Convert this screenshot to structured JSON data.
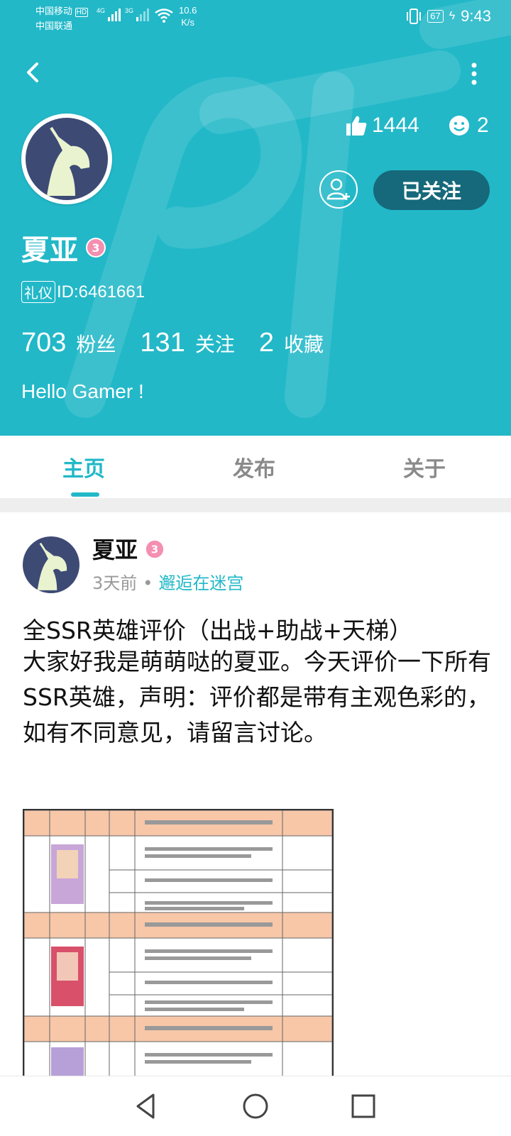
{
  "status_bar": {
    "carrier_1": "中国移动",
    "carrier_2": "中国联通",
    "hd": "HD",
    "net_4g": "4G",
    "net_3g": "3G",
    "speed_value": "10.6",
    "speed_unit": "K/s",
    "battery": "67",
    "time": "9:43"
  },
  "profile": {
    "name": "夏亚",
    "level_badge": "3",
    "tag": "礼仪",
    "id_text": "ID:6461661",
    "likes": "1444",
    "smiles": "2",
    "follow_button": "已关注",
    "stats": [
      {
        "value": "703",
        "label": "粉丝"
      },
      {
        "value": "131",
        "label": "关注"
      },
      {
        "value": "2",
        "label": "收藏"
      }
    ],
    "bio": "Hello Gamer !"
  },
  "tabs": [
    {
      "label": "主页",
      "active": true
    },
    {
      "label": "发布",
      "active": false
    },
    {
      "label": "关于",
      "active": false
    }
  ],
  "post": {
    "author": "夏亚",
    "level_badge": "3",
    "time": "3天前",
    "circle": "邂逅在迷宫",
    "title": "全SSR英雄评价（出战+助战+天梯）",
    "body": "大家好我是萌萌哒的夏亚。今天评价一下所有SSR英雄，声明：评价都是带有主观色彩的，如有不同意见，请留言讨论。"
  },
  "colors": {
    "accent": "#22b8c8",
    "follow_button_bg": "#16697a",
    "level_badge": "#f48fb1",
    "table_header": "#f7c7a8"
  },
  "icons": [
    "back-arrow-icon",
    "more-vertical-icon",
    "thumbs-up-icon",
    "smiley-icon",
    "add-friend-icon",
    "nav-back-icon",
    "nav-home-icon",
    "nav-recents-icon"
  ]
}
